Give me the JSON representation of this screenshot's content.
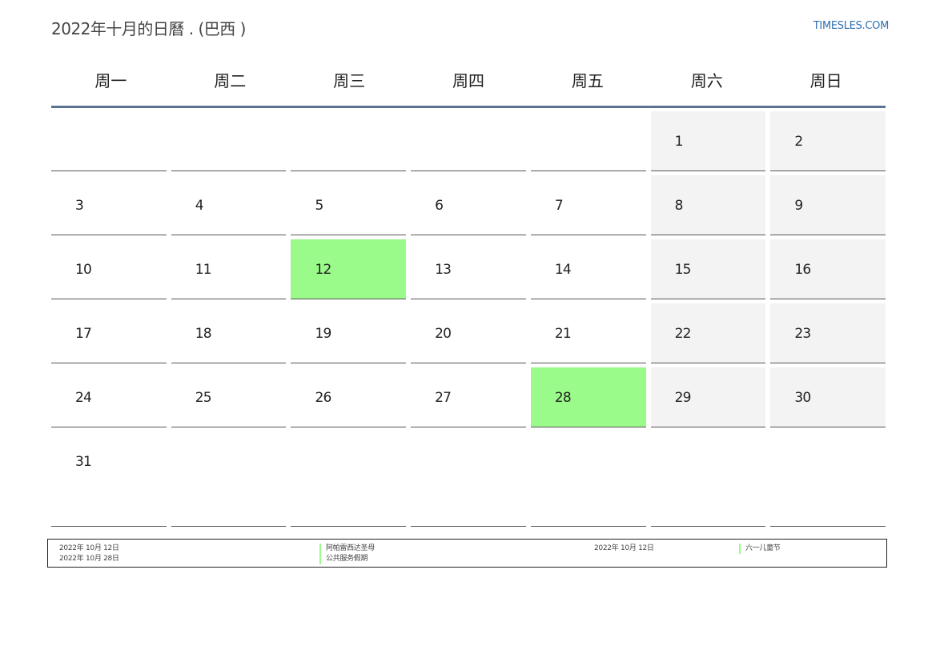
{
  "header": {
    "title": "2022年十月的日曆 . (巴西 )",
    "brand": "TIMESLES.COM"
  },
  "weekdays": [
    "周一",
    "周二",
    "周三",
    "周四",
    "周五",
    "周六",
    "周日"
  ],
  "weeks": [
    [
      "",
      "",
      "",
      "",
      "",
      "1",
      "2"
    ],
    [
      "3",
      "4",
      "5",
      "6",
      "7",
      "8",
      "9"
    ],
    [
      "10",
      "11",
      "12",
      "13",
      "14",
      "15",
      "16"
    ],
    [
      "17",
      "18",
      "19",
      "20",
      "21",
      "22",
      "23"
    ],
    [
      "24",
      "25",
      "26",
      "27",
      "28",
      "29",
      "30"
    ],
    [
      "31",
      "",
      "",
      "",
      "",
      "",
      ""
    ]
  ],
  "holiday_days": [
    "12",
    "28"
  ],
  "colors": {
    "holiday": "#9afa8a",
    "weekend": "#f3f3f3",
    "header_rule": "#5a7394",
    "brand": "#2f6fb0"
  },
  "legend": {
    "col1": [
      "2022年 10月 12日",
      "2022年 10月 28日"
    ],
    "col2": [
      "阿帕雷西达圣母",
      "公共服务假期"
    ],
    "col3": [
      "2022年 10月 12日"
    ],
    "col4": [
      "六一儿童节"
    ]
  }
}
